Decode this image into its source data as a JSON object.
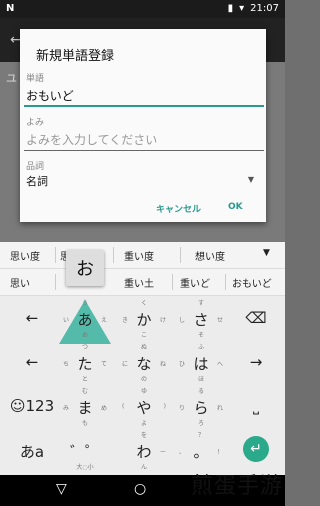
{
  "status": {
    "carrier": "N",
    "time": "21:07"
  },
  "dialog": {
    "title": "新規単語登録",
    "word_label": "単語",
    "word_value": "おもいど",
    "reading_label": "よみ",
    "reading_placeholder": "よみを入力してください",
    "pos_label": "品詞",
    "pos_value": "名詞",
    "cancel": "キャンセル",
    "ok": "OK"
  },
  "suggestions_row1": [
    "思い度",
    "思い土",
    "重い度",
    "想い度"
  ],
  "suggestions_row2": [
    "思い",
    "重い土",
    "重いど",
    "おもいど"
  ],
  "popup_char": "お",
  "keys": [
    {
      "t": "",
      "l": "",
      "main": "←",
      "r": "",
      "b": ""
    },
    {
      "t": "う",
      "l": "い",
      "main": "あ",
      "r": "え",
      "b": "お"
    },
    {
      "t": "く",
      "l": "き",
      "main": "か",
      "r": "け",
      "b": "こ"
    },
    {
      "t": "す",
      "l": "し",
      "main": "さ",
      "r": "せ",
      "b": "そ"
    },
    {
      "t": "",
      "l": "",
      "main": "⌫",
      "r": "",
      "b": ""
    },
    {
      "t": "",
      "l": "",
      "main": "←",
      "r": "",
      "b": ""
    },
    {
      "t": "つ",
      "l": "ち",
      "main": "た",
      "r": "て",
      "b": "と"
    },
    {
      "t": "ぬ",
      "l": "に",
      "main": "な",
      "r": "ね",
      "b": "の"
    },
    {
      "t": "ふ",
      "l": "ひ",
      "main": "は",
      "r": "へ",
      "b": "ほ"
    },
    {
      "t": "",
      "l": "",
      "main": "→",
      "r": "",
      "b": ""
    },
    {
      "t": "",
      "l": "",
      "main": "☺123",
      "r": "",
      "b": ""
    },
    {
      "t": "む",
      "l": "み",
      "main": "ま",
      "r": "め",
      "b": "も"
    },
    {
      "t": "ゆ",
      "l": "(",
      "main": "や",
      "r": ")",
      "b": "よ"
    },
    {
      "t": "る",
      "l": "り",
      "main": "ら",
      "r": "れ",
      "b": "ろ"
    },
    {
      "t": "",
      "l": "",
      "main": "⎵",
      "r": "",
      "b": ""
    },
    {
      "t": "",
      "l": "",
      "main": "あa",
      "r": "",
      "b": ""
    },
    {
      "t": "",
      "l": "",
      "main": "゛゜",
      "r": "",
      "b": "大◌小"
    },
    {
      "t": "を",
      "l": "",
      "main": "わ",
      "r": "ー",
      "b": "ん"
    },
    {
      "t": "？",
      "l": "、",
      "main": "。",
      "r": "！",
      "b": ""
    }
  ],
  "watermark": "煎蛋手游"
}
